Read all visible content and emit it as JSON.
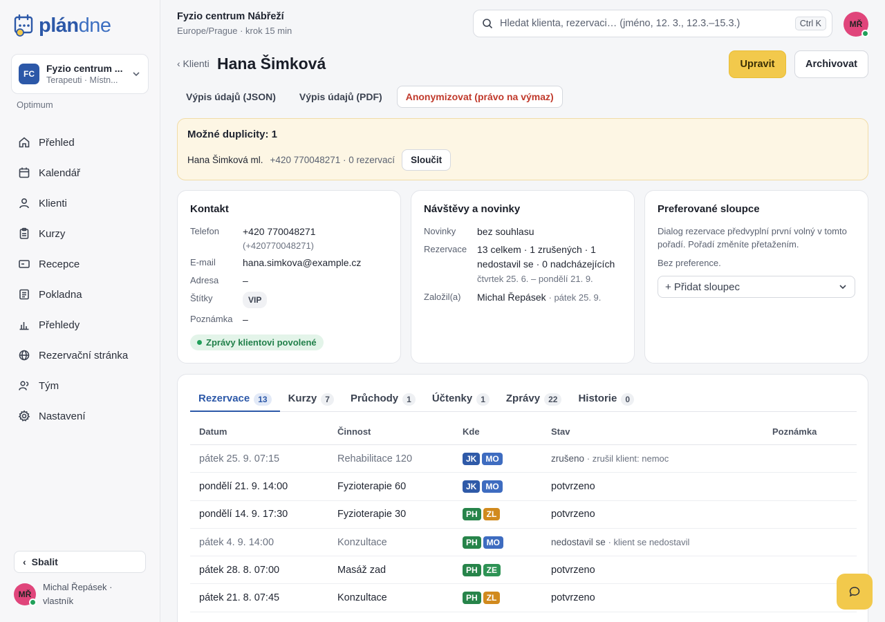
{
  "brand": {
    "name_bold": "plán",
    "name_light": "dne"
  },
  "org": {
    "initials": "FC",
    "name": "Fyzio centrum ...",
    "subtitle": "Terapeuti · Místn...",
    "plan": "Optimum"
  },
  "nav": [
    {
      "label": "Přehled",
      "icon": "home-icon"
    },
    {
      "label": "Kalendář",
      "icon": "calendar-icon"
    },
    {
      "label": "Klienti",
      "icon": "user-icon"
    },
    {
      "label": "Kurzy",
      "icon": "clipboard-icon"
    },
    {
      "label": "Recepce",
      "icon": "card-icon"
    },
    {
      "label": "Pokladna",
      "icon": "receipt-icon"
    },
    {
      "label": "Přehledy",
      "icon": "bar-chart-icon"
    },
    {
      "label": "Rezervační stránka",
      "icon": "globe-icon"
    },
    {
      "label": "Tým",
      "icon": "team-icon"
    },
    {
      "label": "Nastavení",
      "icon": "gear-icon"
    }
  ],
  "sidebar_footer": {
    "collapse_label": "Sbalit",
    "user_initials": "MŘ",
    "user_label": "Michal Řepásek · vlastník"
  },
  "topbar": {
    "title": "Fyzio centrum Nábřeží",
    "subtitle": "Europe/Prague · krok 15 min",
    "search_placeholder": "Hledat klienta, rezervaci… (jméno, 12. 3., 12.3.–15.3.)",
    "search_shortcut": "Ctrl K",
    "avatar_initials": "MŘ"
  },
  "header": {
    "back_label": "‹ Klienti",
    "client_name": "Hana Šimková",
    "edit_label": "Upravit",
    "archive_label": "Archivovat",
    "export_json": "Výpis údajů (JSON)",
    "export_pdf": "Výpis údajů (PDF)",
    "anonymize": "Anonymizovat (právo na výmaz)"
  },
  "duplicates": {
    "title": "Možné duplicity: 1",
    "name": "Hana Šimková ml.",
    "meta": "+420 770048271 · 0 rezervací",
    "merge_label": "Sloučit"
  },
  "contact": {
    "title": "Kontakt",
    "phone_label": "Telefon",
    "phone": "+420 770048271",
    "phone_raw": "(+420770048271)",
    "email_label": "E-mail",
    "email": "hana.simkova@example.cz",
    "address_label": "Adresa",
    "address": "–",
    "tags_label": "Štítky",
    "tag": "VIP",
    "note_label": "Poznámka",
    "note": "–",
    "messages_status": "Zprávy klientovi povolené"
  },
  "visits": {
    "title": "Návštěvy a novinky",
    "news_label": "Novinky",
    "news": "bez souhlasu",
    "reservations_label": "Rezervace",
    "reservations": "13 celkem · 1 zrušených · 1 nedostavil se · 0 nadcházejících",
    "reservations_range": "čtvrtek 25. 6. – pondělí 21. 9.",
    "created_label": "Založil(a)",
    "created_by": "Michal Řepásek",
    "created_on": "· pátek 25. 9."
  },
  "columns_pref": {
    "title": "Preferované sloupce",
    "desc": "Dialog rezervace předvyplní první volný v tomto pořadí. Pořadí změníte přetažením.",
    "none": "Bez preference.",
    "add_label": "+ Přidat sloupec"
  },
  "tabs": [
    {
      "label": "Rezervace",
      "count": "13",
      "active": true
    },
    {
      "label": "Kurzy",
      "count": "7"
    },
    {
      "label": "Průchody",
      "count": "1"
    },
    {
      "label": "Účtenky",
      "count": "1"
    },
    {
      "label": "Zprávy",
      "count": "22"
    },
    {
      "label": "Historie",
      "count": "0"
    }
  ],
  "table": {
    "headers": {
      "date": "Datum",
      "activity": "Činnost",
      "where": "Kde",
      "state": "Stav",
      "note": "Poznámka"
    },
    "rows": [
      {
        "date": "pátek 25. 9. 07:15",
        "activity": "Rehabilitace 120",
        "chips": [
          [
            "JK",
            "#2f5aa8"
          ],
          [
            "MO",
            "#3e6cc0"
          ]
        ],
        "state": "zrušeno",
        "state_detail": "· zrušil klient: nemoc",
        "dim": true
      },
      {
        "date": "pondělí 21. 9. 14:00",
        "activity": "Fyzioterapie 60",
        "chips": [
          [
            "JK",
            "#2f5aa8"
          ],
          [
            "MO",
            "#3e6cc0"
          ]
        ],
        "state": "potvrzeno",
        "state_detail": "",
        "dim": false
      },
      {
        "date": "pondělí 14. 9. 17:30",
        "activity": "Fyzioterapie 30",
        "chips": [
          [
            "PH",
            "#27844a"
          ],
          [
            "ZL",
            "#d18a1e"
          ]
        ],
        "state": "potvrzeno",
        "state_detail": "",
        "dim": false
      },
      {
        "date": "pátek 4. 9. 14:00",
        "activity": "Konzultace",
        "chips": [
          [
            "PH",
            "#27844a"
          ],
          [
            "MO",
            "#3e6cc0"
          ]
        ],
        "state": "nedostavil se",
        "state_detail": "· klient se nedostavil",
        "dim": true
      },
      {
        "date": "pátek 28. 8. 07:00",
        "activity": "Masáž zad",
        "chips": [
          [
            "PH",
            "#27844a"
          ],
          [
            "ZE",
            "#2e9355"
          ]
        ],
        "state": "potvrzeno",
        "state_detail": "",
        "dim": false
      },
      {
        "date": "pátek 21. 8. 07:45",
        "activity": "Konzultace",
        "chips": [
          [
            "PH",
            "#27844a"
          ],
          [
            "ZL",
            "#d18a1e"
          ]
        ],
        "state": "potvrzeno",
        "state_detail": "",
        "dim": false
      }
    ]
  },
  "colors": {
    "accent": "#2c58a8",
    "primary_button": "#f2c94c",
    "success": "#21a05a",
    "danger": "#c0392b"
  }
}
